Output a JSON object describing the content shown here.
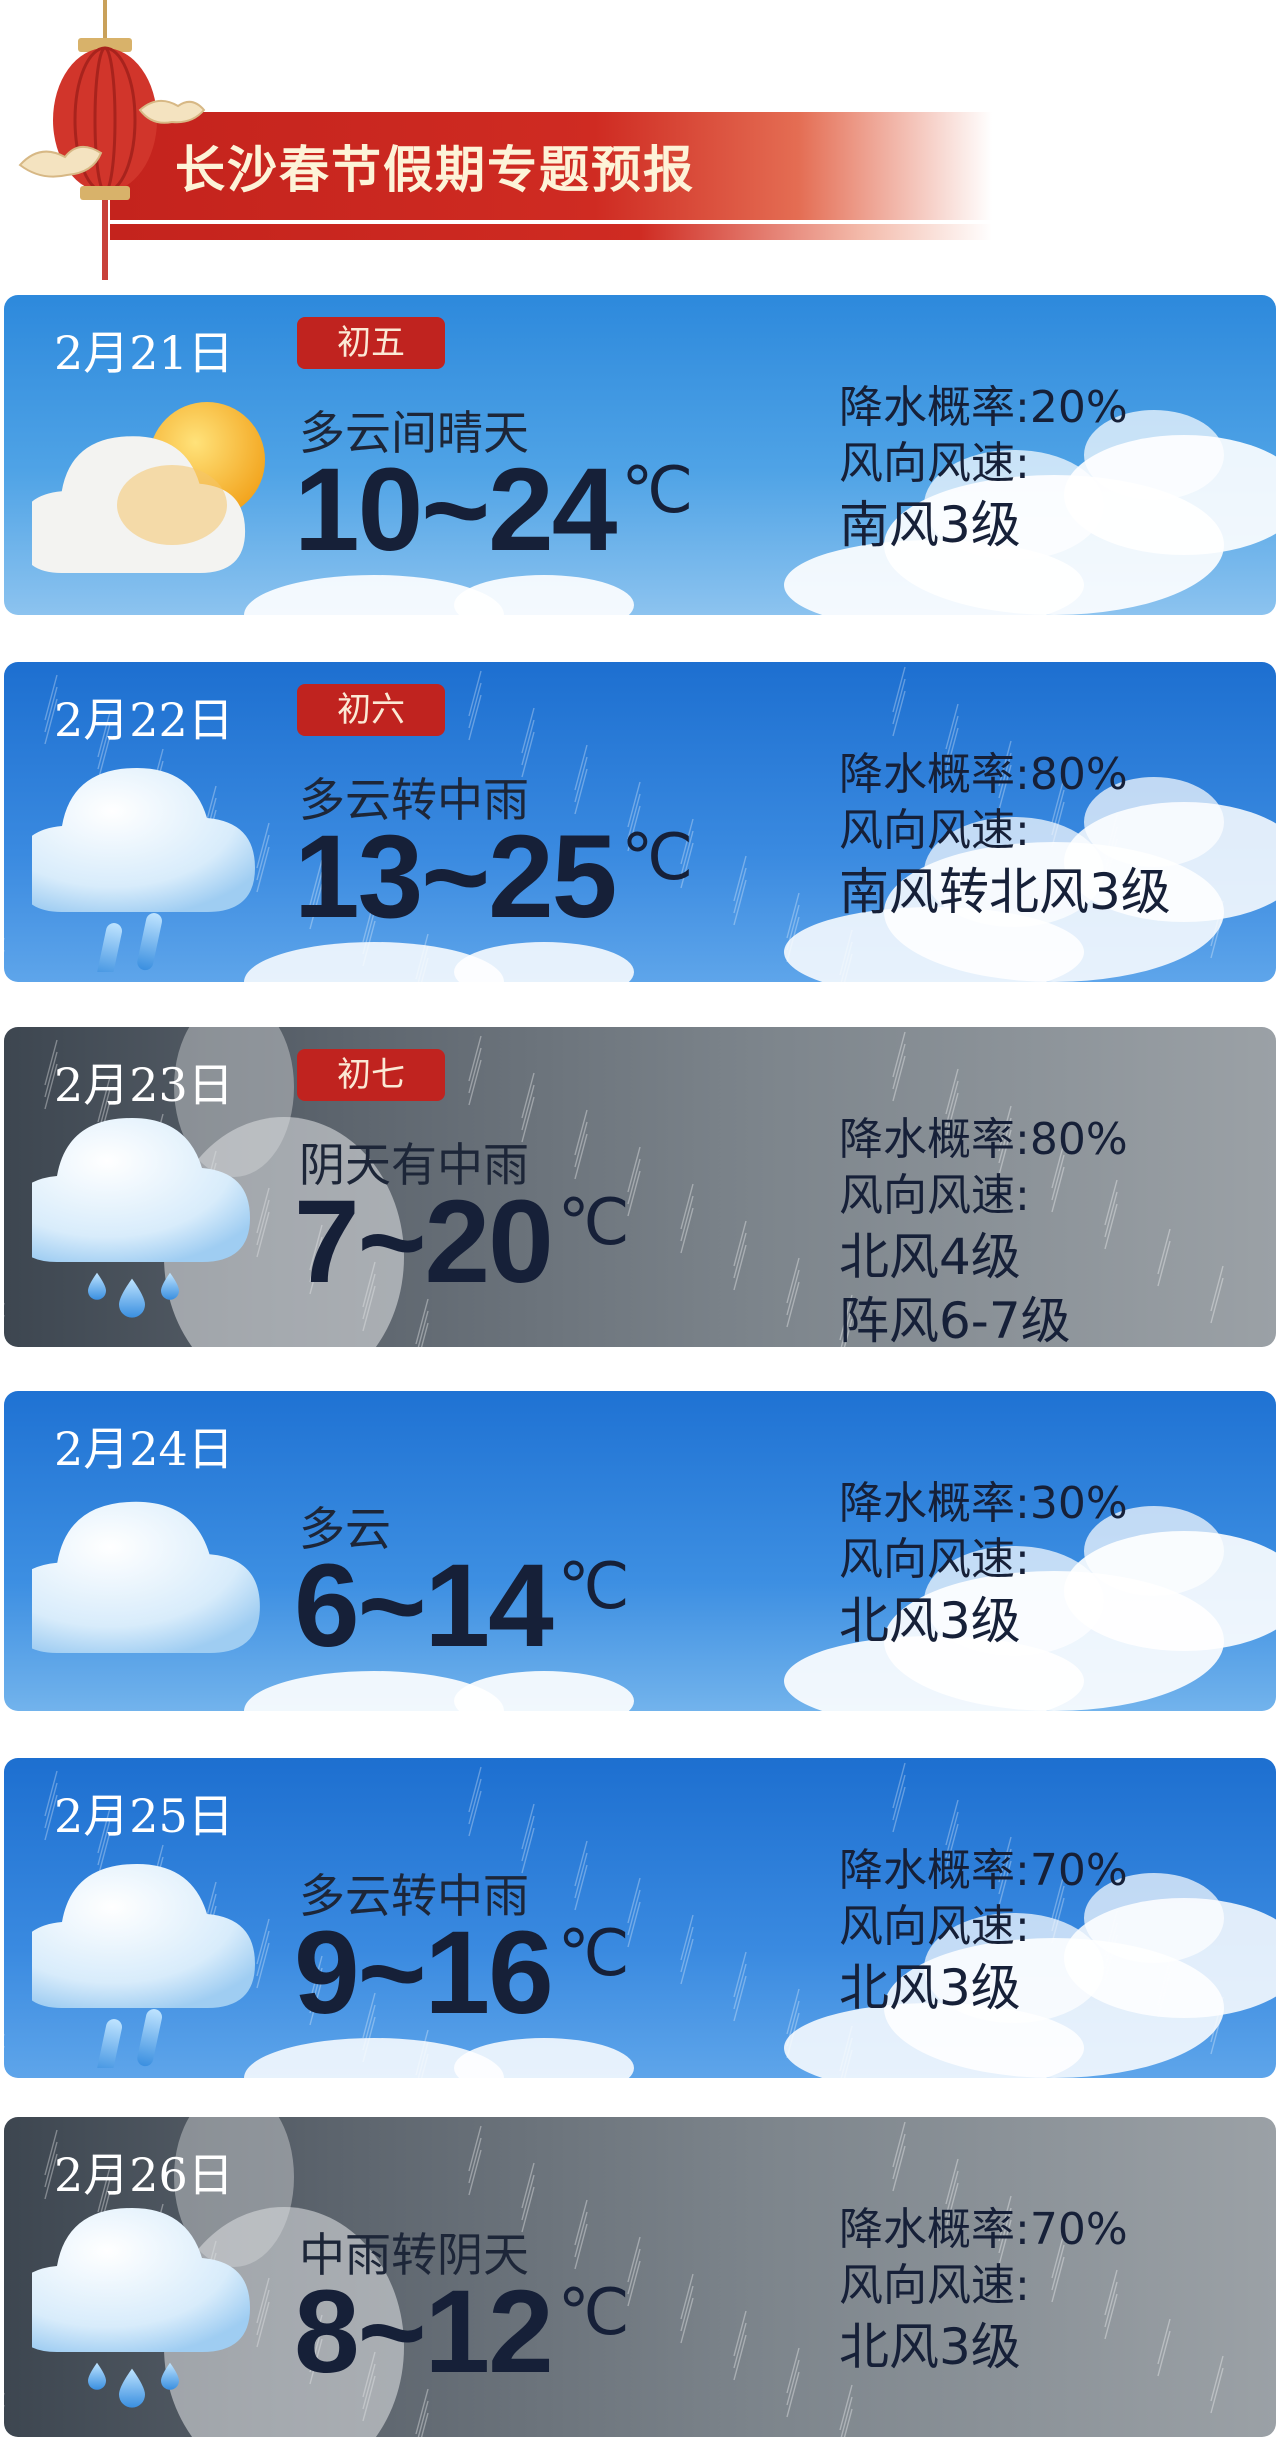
{
  "header": {
    "title": "长沙春节假期专题预报"
  },
  "days": [
    {
      "date": "2月21日",
      "lunar": "初五",
      "condition": "多云间晴天",
      "temp": "10~24",
      "unit": "℃",
      "precip_label": "降水概率:",
      "precip_value": "20%",
      "wind_label": "风向风速:",
      "wind": [
        "南风3级"
      ],
      "icon": "cloud-sun-icon",
      "theme": "sunny"
    },
    {
      "date": "2月22日",
      "lunar": "初六",
      "condition": "多云转中雨",
      "temp": "13~25",
      "unit": "℃",
      "precip_label": "降水概率:",
      "precip_value": "80%",
      "wind_label": "风向风速:",
      "wind": [
        "南风转北风3级"
      ],
      "icon": "cloud-rain-icon",
      "theme": "rain"
    },
    {
      "date": "2月23日",
      "lunar": "初七",
      "condition": "阴天有中雨",
      "temp": "7~20",
      "unit": "℃",
      "precip_label": "降水概率:",
      "precip_value": "80%",
      "wind_label": "风向风速:",
      "wind": [
        "北风4级",
        "阵风6-7级"
      ],
      "icon": "cloud-drops-icon",
      "theme": "storm"
    },
    {
      "date": "2月24日",
      "lunar": "",
      "condition": "多云",
      "temp": "6~14",
      "unit": "℃",
      "precip_label": "降水概率:",
      "precip_value": "30%",
      "wind_label": "风向风速:",
      "wind": [
        "北风3级"
      ],
      "icon": "cloud-icon",
      "theme": "cloud"
    },
    {
      "date": "2月25日",
      "lunar": "",
      "condition": "多云转中雨",
      "temp": "9~16",
      "unit": "℃",
      "precip_label": "降水概率:",
      "precip_value": "70%",
      "wind_label": "风向风速:",
      "wind": [
        "北风3级"
      ],
      "icon": "cloud-rain-icon",
      "theme": "rain"
    },
    {
      "date": "2月26日",
      "lunar": "",
      "condition": "中雨转阴天",
      "temp": "8~12",
      "unit": "℃",
      "precip_label": "降水概率:",
      "precip_value": "70%",
      "wind_label": "风向风速:",
      "wind": [
        "北风3级"
      ],
      "icon": "cloud-drops-icon",
      "theme": "storm"
    }
  ]
}
